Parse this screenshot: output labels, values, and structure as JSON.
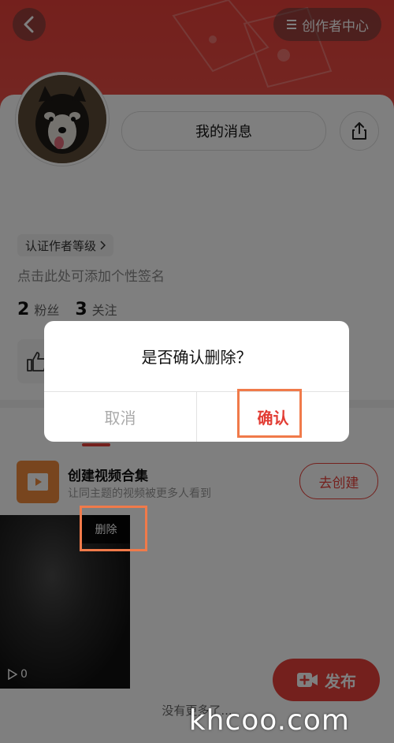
{
  "header": {
    "back_icon": "chevron-left-icon",
    "creator_center_label": "创作者中心",
    "creator_center_icon": "menu-lines-icon"
  },
  "profile": {
    "avatar_icon": "dog-avatar",
    "my_messages_label": "我的消息",
    "share_icon": "share-icon",
    "level_tag_label": "认证作者等级",
    "signature_placeholder": "点击此处可添加个性签名",
    "followers_count": "2",
    "followers_label": "粉丝",
    "following_count": "3",
    "following_label": "关注"
  },
  "collection": {
    "title": "创建视频合集",
    "subtitle": "让同主题的视频被更多人看到",
    "create_label": "去创建"
  },
  "video": {
    "delete_label": "删除",
    "play_count": "0"
  },
  "publish_label": "发布",
  "no_more_label": "没有更多了...",
  "watermark": "khcoo.com",
  "dialog": {
    "title": "是否确认删除？",
    "cancel_label": "取消",
    "confirm_label": "确认"
  },
  "colors": {
    "brand_red": "#e8413a",
    "highlight_orange": "#f07a4a"
  }
}
